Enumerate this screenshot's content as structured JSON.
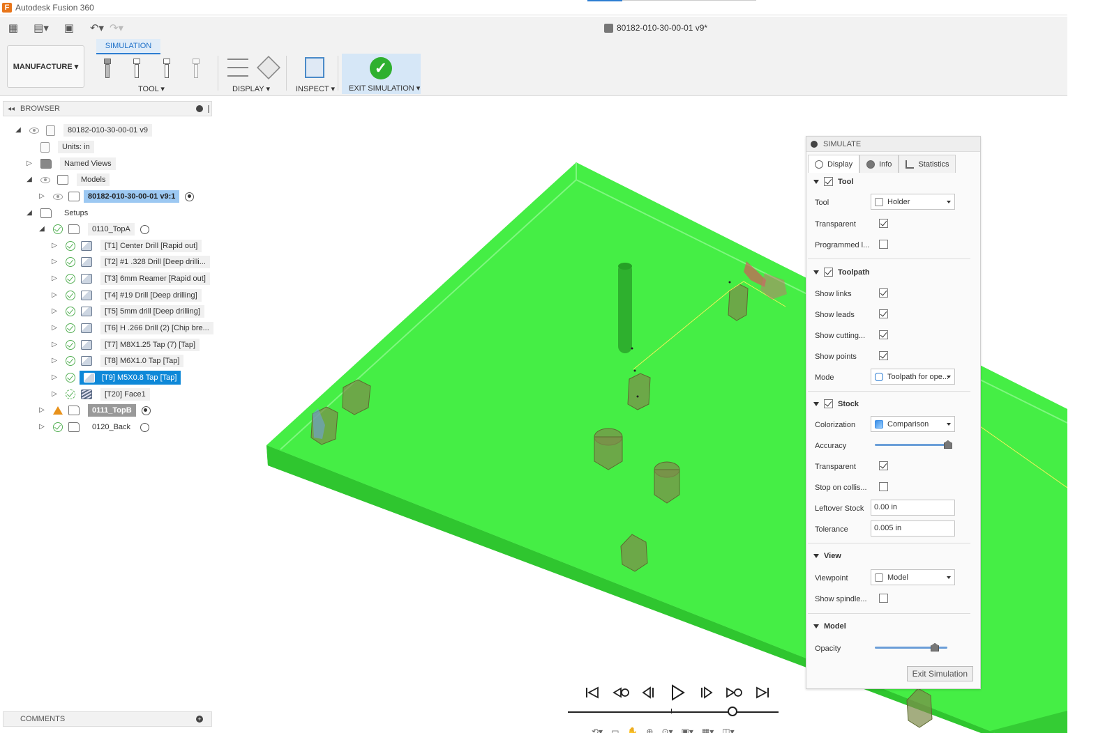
{
  "app": {
    "title": "Autodesk Fusion 360",
    "icon_letter": "F"
  },
  "document": {
    "title": "80182-010-30-00-01 v9*"
  },
  "toolbar": {
    "workspace": "MANUFACTURE ▾",
    "active_tab": "SIMULATION",
    "groups": {
      "tool": "TOOL ▾",
      "display": "DISPLAY ▾",
      "inspect": "INSPECT ▾",
      "exit": "EXIT SIMULATION ▾"
    }
  },
  "browser": {
    "header": "BROWSER",
    "root": "80182-010-30-00-01 v9",
    "units": "Units: in",
    "named_views": "Named Views",
    "models": "Models",
    "model_item": "80182-010-30-00-01 v9:1",
    "setups": "Setups",
    "setup_a": "0110_TopA",
    "operations": [
      "[T1] Center Drill [Rapid out]",
      "[T2] #1 .328 Drill [Deep drilli...",
      "[T3] 6mm Reamer [Rapid out]",
      "[T4] #19 Drill [Deep drilling]",
      "[T5] 5mm drill [Deep drilling]",
      "[T6] H .266 Drill (2) [Chip bre...",
      "[T7] M8X1.25 Tap (7) [Tap]",
      "[T8] M6X1.0 Tap [Tap]",
      "[T9] M5X0.8 Tap [Tap]",
      "[T20] Face1"
    ],
    "setup_b": "0111_TopB",
    "setup_back": "0120_Back"
  },
  "comments": {
    "label": "COMMENTS"
  },
  "simulate": {
    "title": "SIMULATE",
    "tabs": [
      "Display",
      "Info",
      "Statistics"
    ],
    "tool_section": {
      "label": "Tool",
      "checked": true
    },
    "tool_fields": {
      "tool_label": "Tool",
      "tool_value": "Holder",
      "transparent_label": "Transparent",
      "transparent": true,
      "programmed_label": "Programmed l...",
      "programmed": false
    },
    "toolpath_section": {
      "label": "Toolpath",
      "checked": true
    },
    "toolpath_fields": {
      "show_links_label": "Show links",
      "show_links": true,
      "show_leads_label": "Show leads",
      "show_leads": true,
      "show_cutting_label": "Show cutting...",
      "show_cutting": true,
      "show_points_label": "Show points",
      "show_points": true,
      "mode_label": "Mode",
      "mode_value": "Toolpath for ope..."
    },
    "stock_section": {
      "label": "Stock",
      "checked": true
    },
    "stock_fields": {
      "colorization_label": "Colorization",
      "colorization_value": "Comparison",
      "accuracy_label": "Accuracy",
      "accuracy": 0.95,
      "transparent_label": "Transparent",
      "transparent": true,
      "stop_label": "Stop on collis...",
      "stop": false,
      "leftover_label": "Leftover Stock",
      "leftover_value": "0.00 in",
      "tolerance_label": "Tolerance",
      "tolerance_value": "0.005 in"
    },
    "view_section": {
      "label": "View"
    },
    "view_fields": {
      "viewpoint_label": "Viewpoint",
      "viewpoint_value": "Model",
      "spindle_label": "Show spindle...",
      "spindle": false
    },
    "model_section": {
      "label": "Model"
    },
    "model_fields": {
      "opacity_label": "Opacity",
      "opacity": 0.77
    },
    "exit_button": "Exit Simulation"
  },
  "playback": {
    "position": 0.78
  },
  "colors": {
    "stock_green": "#45ee45",
    "accent": "#2d7dd2",
    "selected": "#0e88d8"
  }
}
